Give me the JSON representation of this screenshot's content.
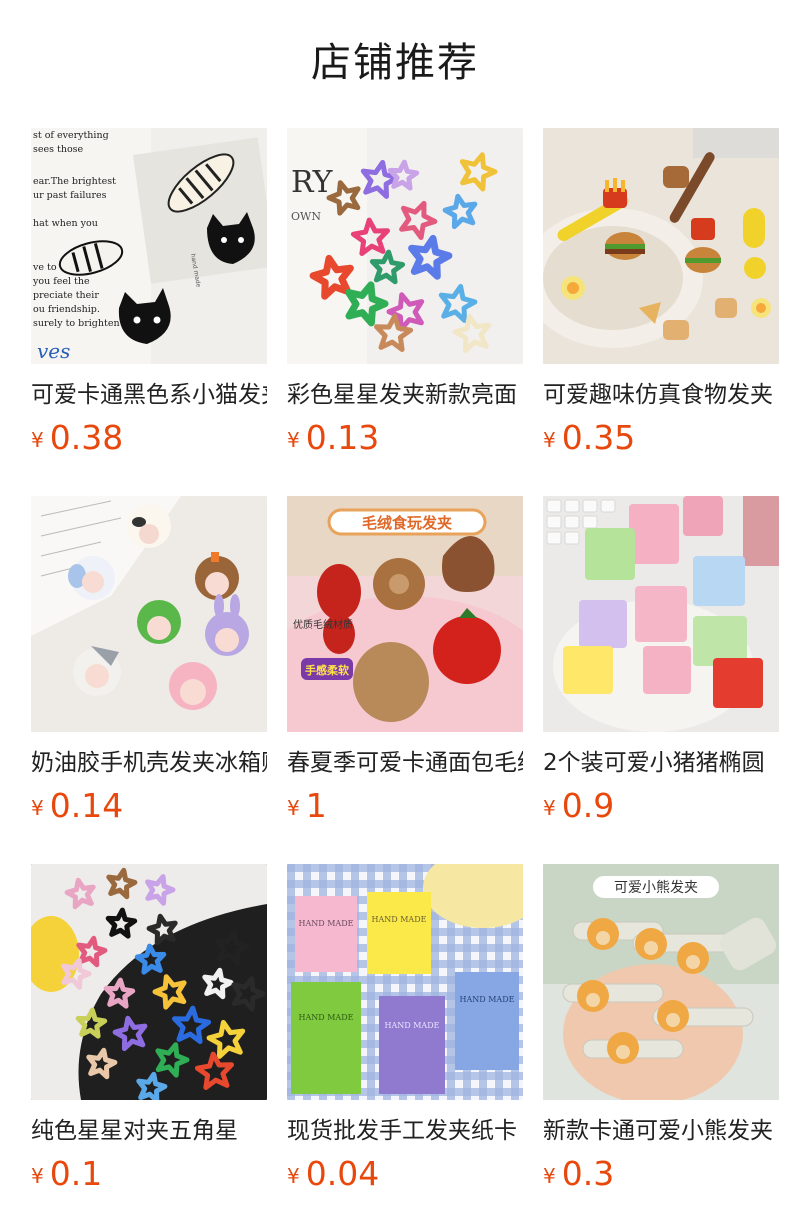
{
  "page_title": "店铺推荐",
  "currency": "¥",
  "colors": {
    "price": "#e8480c",
    "title": "#1a1a1a"
  },
  "products": [
    {
      "name": "可爱卡通黑色系小猫发夹",
      "price": "0.38",
      "image_text": [
        "st of everything",
        "sees those",
        "ear.The brightest",
        "ur past failures",
        "hat when you",
        "ve to",
        "you feel the",
        "preciate their",
        "ou friendship.",
        "surely to brighten",
        "ves",
        "hand made"
      ]
    },
    {
      "name": "彩色星星发夹新款亮面",
      "price": "0.13",
      "image_text": [
        "RY",
        "OWN"
      ]
    },
    {
      "name": "可爱趣味仿真食物发夹",
      "price": "0.35",
      "image_text": []
    },
    {
      "name": "奶油胶手机壳发夹冰箱贴",
      "price": "0.14",
      "image_text": []
    },
    {
      "name": "春夏季可爱卡通面包毛绒",
      "price": "1",
      "image_text": [
        "毛绒食玩发夹",
        "优质毛绒材质",
        "手感柔软"
      ]
    },
    {
      "name": "2个装可爱小猪猪椭圆",
      "price": "0.9",
      "image_text": []
    },
    {
      "name": "纯色星星对夹五角星",
      "price": "0.1",
      "image_text": []
    },
    {
      "name": "现货批发手工发夹纸卡",
      "price": "0.04",
      "image_text": [
        "HAND MADE",
        "HAND MADE",
        "HAND MADE",
        "HAND MADE",
        "HAND MADE"
      ]
    },
    {
      "name": "新款卡通可爱小熊发夹",
      "price": "0.3",
      "image_text": [
        "可爱小熊发夹"
      ]
    }
  ]
}
